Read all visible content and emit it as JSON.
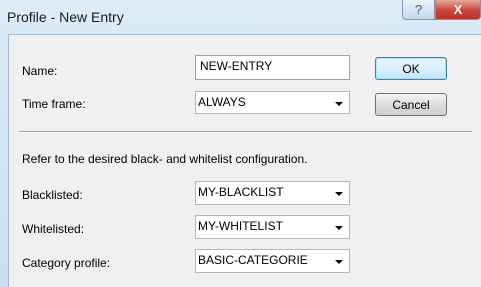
{
  "window": {
    "title": "Profile - New Entry",
    "help_glyph": "?",
    "close_glyph": "X"
  },
  "form": {
    "name_label": "Name:",
    "name_value": "NEW-ENTRY",
    "timeframe_label": "Time frame:",
    "timeframe_value": "ALWAYS",
    "note": "Refer to the desired black- and whitelist configuration.",
    "blacklisted_label": "Blacklisted:",
    "blacklisted_value": "MY-BLACKLIST",
    "whitelisted_label": "Whitelisted:",
    "whitelisted_value": "MY-WHITELIST",
    "category_label": "Category profile:",
    "category_value": "BASIC-CATEGORIE"
  },
  "buttons": {
    "ok": "OK",
    "cancel": "Cancel"
  }
}
